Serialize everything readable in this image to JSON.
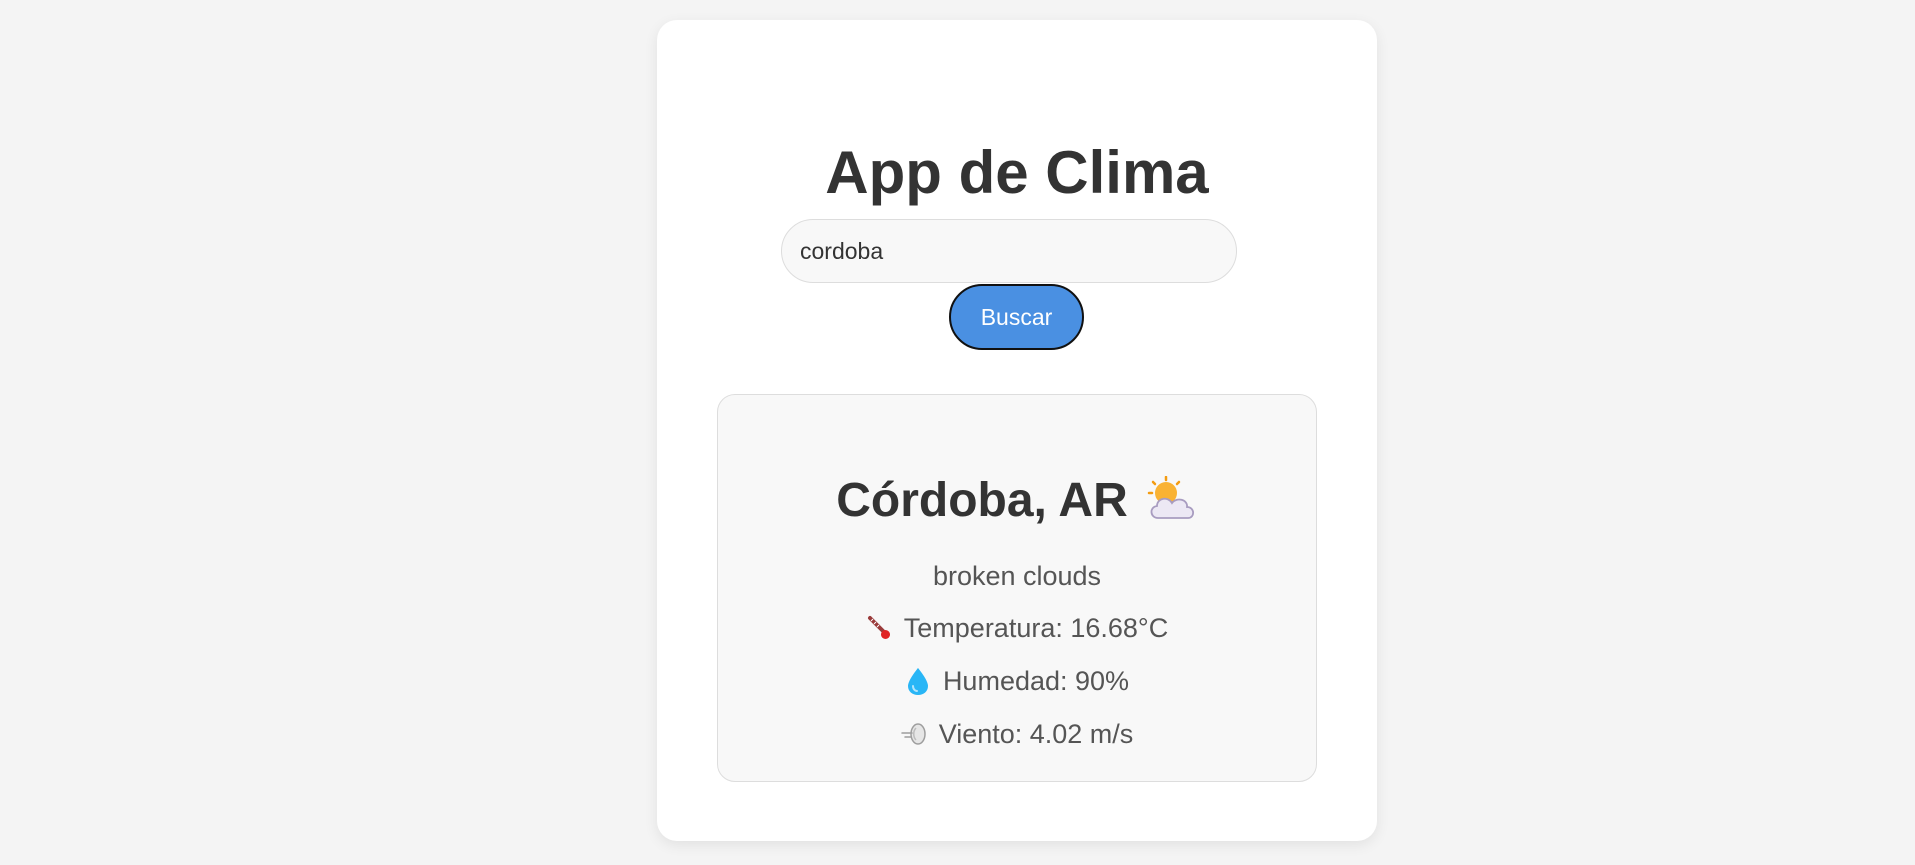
{
  "app": {
    "title": "App de Clima"
  },
  "search": {
    "value": "cordoba",
    "button_label": "Buscar"
  },
  "weather": {
    "city": "Córdoba, AR",
    "condition_icon": "sun-behind-cloud-icon",
    "description": "broken clouds",
    "temperature": {
      "icon": "thermometer-icon",
      "text": "Temperatura: 16.68°C"
    },
    "humidity": {
      "icon": "droplet-icon",
      "text": "Humedad: 90%"
    },
    "wind": {
      "icon": "wind-icon",
      "text": "Viento: 4.02 m/s"
    }
  },
  "colors": {
    "background": "#f4f4f4",
    "card": "#ffffff",
    "accent": "#4a90e2",
    "title_text": "#333333",
    "body_text": "#555555"
  }
}
